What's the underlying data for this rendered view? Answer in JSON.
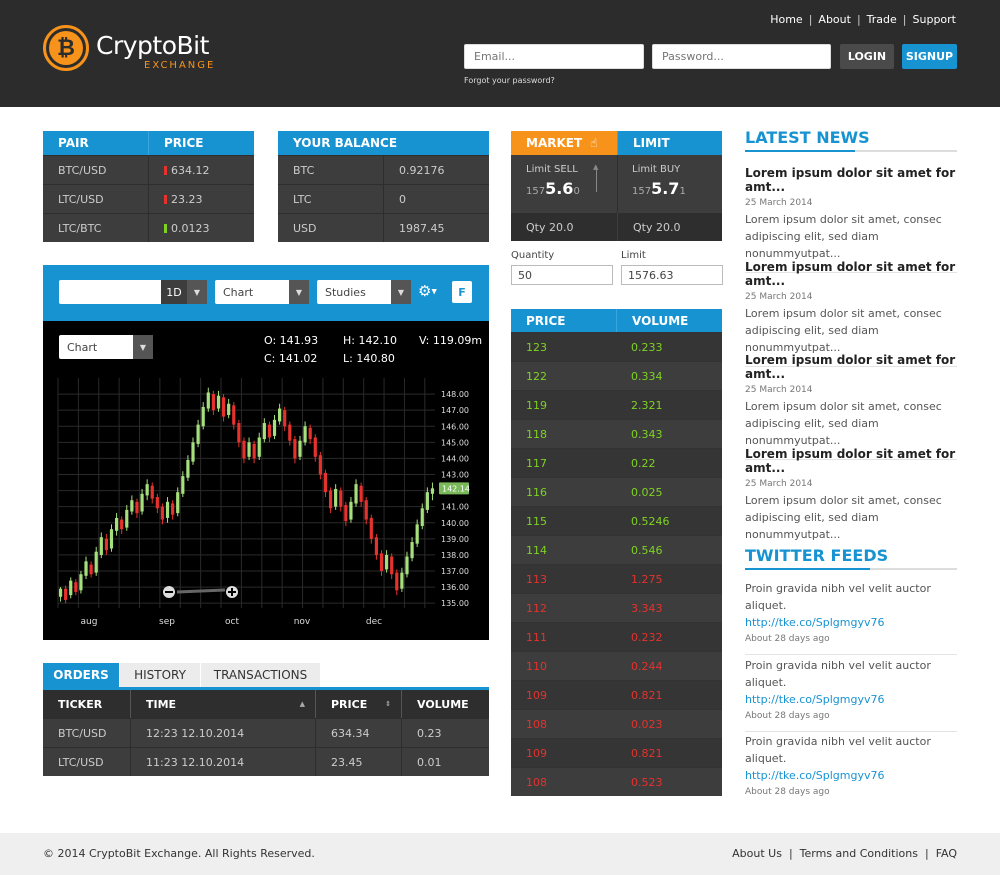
{
  "brand": {
    "name": "CryptoBit",
    "sub": "EXCHANGE",
    "coin": "₿"
  },
  "nav": {
    "items": [
      "Home",
      "About",
      "Trade",
      "Support"
    ]
  },
  "login": {
    "email_placeholder": "Email...",
    "password_placeholder": "Password...",
    "login_label": "LOGIN",
    "signup_label": "SIGNUP",
    "forgot": "Forgot your password?"
  },
  "pairs": {
    "headers": [
      "PAIR",
      "PRICE"
    ],
    "rows": [
      {
        "pair": "BTC/USD",
        "price": "634.12",
        "dir": "down"
      },
      {
        "pair": "LTC/USD",
        "price": "23.23",
        "dir": "down"
      },
      {
        "pair": "LTC/BTC",
        "price": "0.0123",
        "dir": "up"
      }
    ]
  },
  "balance": {
    "header": "YOUR BALANCE",
    "rows": [
      {
        "cur": "BTC",
        "val": "0.92176"
      },
      {
        "cur": "LTC",
        "val": "0"
      },
      {
        "cur": "USD",
        "val": "1987.45"
      }
    ]
  },
  "chart_toolbar": {
    "interval": "1D",
    "chart_select": "Chart",
    "studies_select": "Studies",
    "f_label": "F",
    "gear": "gear-icon"
  },
  "chart_info": {
    "type_select": "Chart",
    "o": "O: 141.93",
    "h": "H: 142.10",
    "v": "V: 119.09m",
    "c": "C: 141.02",
    "l": "L: 140.80"
  },
  "chart_data": {
    "type": "candlestick",
    "x_ticks": [
      "aug",
      "sep",
      "oct",
      "nov",
      "dec"
    ],
    "y_ticks": [
      "148.00",
      "147.00",
      "146.00",
      "145.00",
      "144.00",
      "143.00",
      "142.14",
      "141.00",
      "140.00",
      "139.00",
      "138.00",
      "137.00",
      "136.00",
      "135.00"
    ],
    "ylim": [
      134.7,
      149
    ],
    "current_price": 142.14,
    "current_price_label": "142.14",
    "grid": true,
    "candles": [
      [
        135.4,
        135.9,
        135.1,
        136.0
      ],
      [
        135.9,
        135.2,
        135.0,
        136.1
      ],
      [
        135.5,
        136.4,
        135.3,
        136.6
      ],
      [
        136.3,
        135.7,
        135.5,
        136.5
      ],
      [
        135.8,
        136.8,
        135.6,
        137.0
      ],
      [
        136.7,
        137.6,
        136.5,
        137.9
      ],
      [
        137.4,
        136.8,
        136.6,
        137.6
      ],
      [
        136.9,
        138.2,
        136.7,
        138.5
      ],
      [
        138.0,
        139.1,
        137.8,
        139.4
      ],
      [
        139.0,
        138.3,
        138.0,
        139.3
      ],
      [
        138.4,
        139.6,
        138.2,
        139.9
      ],
      [
        139.5,
        140.3,
        139.2,
        140.6
      ],
      [
        140.2,
        139.6,
        139.3,
        140.4
      ],
      [
        139.7,
        140.8,
        139.5,
        141.1
      ],
      [
        140.7,
        141.4,
        140.5,
        141.7
      ],
      [
        141.3,
        140.6,
        140.3,
        141.5
      ],
      [
        140.7,
        141.8,
        140.5,
        142.1
      ],
      [
        141.7,
        142.4,
        141.4,
        142.7
      ],
      [
        142.3,
        141.5,
        141.2,
        142.5
      ],
      [
        141.6,
        140.9,
        140.6,
        141.8
      ],
      [
        141.0,
        140.2,
        139.9,
        141.2
      ],
      [
        140.3,
        141.3,
        140.0,
        141.6
      ],
      [
        141.2,
        140.5,
        140.2,
        141.4
      ],
      [
        140.6,
        141.9,
        140.4,
        142.2
      ],
      [
        141.8,
        142.9,
        141.6,
        143.2
      ],
      [
        142.8,
        143.9,
        142.6,
        144.2
      ],
      [
        143.8,
        145.0,
        143.6,
        145.3
      ],
      [
        144.9,
        146.1,
        144.7,
        146.4
      ],
      [
        146.0,
        147.2,
        145.8,
        147.5
      ],
      [
        147.1,
        148.1,
        146.9,
        148.4
      ],
      [
        148.0,
        147.0,
        146.7,
        148.2
      ],
      [
        147.1,
        147.9,
        146.9,
        148.2
      ],
      [
        147.8,
        146.6,
        146.3,
        148.0
      ],
      [
        146.7,
        147.4,
        146.5,
        147.7
      ],
      [
        147.3,
        146.1,
        145.8,
        147.5
      ],
      [
        146.2,
        145.0,
        144.7,
        146.4
      ],
      [
        145.1,
        144.0,
        143.7,
        145.3
      ],
      [
        144.1,
        145.0,
        143.9,
        145.3
      ],
      [
        144.9,
        144.0,
        143.7,
        145.1
      ],
      [
        144.1,
        145.3,
        143.9,
        145.6
      ],
      [
        145.2,
        146.2,
        145.0,
        146.5
      ],
      [
        146.1,
        145.3,
        145.0,
        146.3
      ],
      [
        145.4,
        146.4,
        145.2,
        146.7
      ],
      [
        146.3,
        147.1,
        146.1,
        147.4
      ],
      [
        147.0,
        146.0,
        145.7,
        147.2
      ],
      [
        146.1,
        145.1,
        144.8,
        146.3
      ],
      [
        145.2,
        144.0,
        143.7,
        145.4
      ],
      [
        144.1,
        145.1,
        143.9,
        145.4
      ],
      [
        145.0,
        146.0,
        144.8,
        146.3
      ],
      [
        145.9,
        145.2,
        144.9,
        146.1
      ],
      [
        145.3,
        144.1,
        143.8,
        145.5
      ],
      [
        144.2,
        143.0,
        142.7,
        144.4
      ],
      [
        143.1,
        141.9,
        141.6,
        143.3
      ],
      [
        142.0,
        140.9,
        140.6,
        142.2
      ],
      [
        141.0,
        142.1,
        140.8,
        142.4
      ],
      [
        142.0,
        141.0,
        140.7,
        142.2
      ],
      [
        141.1,
        140.1,
        139.8,
        141.3
      ],
      [
        140.2,
        141.3,
        140.0,
        141.6
      ],
      [
        141.2,
        142.4,
        141.0,
        142.7
      ],
      [
        142.3,
        141.3,
        141.0,
        142.5
      ],
      [
        141.4,
        140.2,
        139.9,
        141.6
      ],
      [
        140.3,
        139.0,
        138.7,
        140.5
      ],
      [
        139.1,
        138.0,
        137.7,
        139.3
      ],
      [
        138.1,
        137.0,
        136.7,
        138.3
      ],
      [
        137.1,
        138.0,
        136.9,
        138.3
      ],
      [
        137.9,
        136.8,
        136.5,
        138.1
      ],
      [
        136.9,
        135.8,
        135.5,
        137.1
      ],
      [
        135.9,
        136.9,
        135.7,
        137.2
      ],
      [
        136.8,
        137.9,
        136.6,
        138.2
      ],
      [
        137.8,
        138.8,
        137.6,
        139.1
      ],
      [
        138.7,
        139.9,
        138.5,
        140.2
      ],
      [
        139.8,
        140.9,
        139.6,
        141.2
      ],
      [
        140.8,
        141.9,
        140.6,
        142.2
      ],
      [
        141.8,
        142.14,
        141.4,
        142.5
      ]
    ]
  },
  "orders": {
    "tabs": [
      "ORDERS",
      "HISTORY",
      "TRANSACTIONS"
    ],
    "headers": [
      "TICKER",
      "TIME",
      "PRICE",
      "VOLUME"
    ],
    "rows": [
      {
        "ticker": "BTC/USD",
        "time": "12:23  12.10.2014",
        "price": "634.34",
        "volume": "0.23"
      },
      {
        "ticker": "LTC/USD",
        "time": "11:23  12.10.2014",
        "price": "23.45",
        "volume": "0.01"
      }
    ]
  },
  "trade": {
    "tab_market": "MARKET",
    "tab_limit": "LIMIT",
    "sell_label": "Limit SELL",
    "sell_small1": "157",
    "sell_big": "5.6",
    "sell_small2": "0",
    "buy_label": "Limit BUY",
    "buy_small1": "157",
    "buy_big": "5.7",
    "buy_small2": "1",
    "qty_sell": "Qty  20.0",
    "qty_buy": "Qty  20.0",
    "quantity_label": "Quantity",
    "limit_label": "Limit",
    "quantity_value": "50",
    "limit_value": "1576.63"
  },
  "orderbook": {
    "headers": [
      "PRICE",
      "VOLUME"
    ],
    "rows": [
      {
        "price": "123",
        "volume": "0.233",
        "side": "buy"
      },
      {
        "price": "122",
        "volume": "0.334",
        "side": "buy"
      },
      {
        "price": "119",
        "volume": "2.321",
        "side": "buy"
      },
      {
        "price": "118",
        "volume": "0.343",
        "side": "buy"
      },
      {
        "price": "117",
        "volume": "0.22",
        "side": "buy"
      },
      {
        "price": "116",
        "volume": "0.025",
        "side": "buy"
      },
      {
        "price": "115",
        "volume": "0.5246",
        "side": "buy"
      },
      {
        "price": "114",
        "volume": "0.546",
        "side": "buy"
      },
      {
        "price": "113",
        "volume": "1.275",
        "side": "sell"
      },
      {
        "price": "112",
        "volume": "3.343",
        "side": "sell"
      },
      {
        "price": "111",
        "volume": "0.232",
        "side": "sell"
      },
      {
        "price": "110",
        "volume": "0.244",
        "side": "sell"
      },
      {
        "price": "109",
        "volume": "0.821",
        "side": "sell"
      },
      {
        "price": "108",
        "volume": "0.023",
        "side": "sell"
      },
      {
        "price": "109",
        "volume": "0.821",
        "side": "sell"
      },
      {
        "price": "108",
        "volume": "0.523",
        "side": "sell"
      }
    ]
  },
  "news": {
    "title": "LATEST NEWS",
    "items": [
      {
        "title": "Lorem ipsum dolor sit amet for amt...",
        "date": "25 March 2014",
        "body1": "Lorem ipsum dolor sit amet, consec",
        "body2": "adipiscing elit, sed diam nonummyutpat..."
      },
      {
        "title": "Lorem ipsum dolor sit amet for amt...",
        "date": "25 March 2014",
        "body1": "Lorem ipsum dolor sit amet, consec",
        "body2": "adipiscing elit, sed diam nonummyutpat..."
      },
      {
        "title": "Lorem ipsum dolor sit amet for amt...",
        "date": "25 March 2014",
        "body1": "Lorem ipsum dolor sit amet, consec",
        "body2": "adipiscing elit, sed diam nonummyutpat..."
      },
      {
        "title": "Lorem ipsum dolor sit amet for amt...",
        "date": "25 March 2014",
        "body1": "Lorem ipsum dolor sit amet, consec",
        "body2": "adipiscing elit, sed diam nonummyutpat..."
      }
    ]
  },
  "twitter": {
    "title": "TWITTER FEEDS",
    "items": [
      {
        "text": "Proin gravida nibh vel velit auctor aliquet.",
        "link": "http://tke.co/Splgmgyv76",
        "time": "About 28 days ago"
      },
      {
        "text": "Proin gravida nibh vel velit auctor aliquet.",
        "link": "http://tke.co/Splgmgyv76",
        "time": "About 28 days ago"
      },
      {
        "text": "Proin gravida nibh vel velit auctor aliquet.",
        "link": "http://tke.co/Splgmgyv76",
        "time": "About 28 days ago"
      }
    ]
  },
  "footer": {
    "copyright": "© 2014 CryptoBit Exchange. All Rights Reserved.",
    "links": [
      "About Us",
      "Terms and Conditions",
      "FAQ"
    ]
  },
  "colors": {
    "accent": "#1793d2",
    "orange": "#f7931a",
    "buy": "#7ed321",
    "sell": "#e5322d",
    "dark": "#2c2c2c"
  }
}
